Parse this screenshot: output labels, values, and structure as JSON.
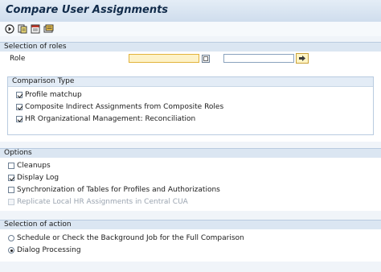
{
  "window": {
    "title": "Compare User Assignments"
  },
  "toolbar": {
    "buttons": [
      {
        "icon": "execute-icon"
      },
      {
        "icon": "get-variant-icon"
      },
      {
        "icon": "save-variant-icon"
      },
      {
        "icon": "program-documentation-icon"
      }
    ]
  },
  "selection_of_roles": {
    "header": "Selection of roles",
    "role_label": "Role",
    "role_from": "",
    "role_to": "",
    "comparison_type": {
      "header": "Comparison Type",
      "options": [
        {
          "label": "Profile matchup",
          "checked": true
        },
        {
          "label": "Composite Indirect Assignments from Composite Roles",
          "checked": true
        },
        {
          "label": "HR Organizational Management: Reconciliation",
          "checked": true
        }
      ]
    }
  },
  "options": {
    "header": "Options",
    "items": [
      {
        "label": "Cleanups",
        "checked": false,
        "enabled": true
      },
      {
        "label": "Display Log",
        "checked": true,
        "enabled": true
      },
      {
        "label": "Synchronization of Tables for Profiles and Authorizations",
        "checked": false,
        "enabled": true
      },
      {
        "label": "Replicate Local HR Assignments in Central CUA",
        "checked": false,
        "enabled": false
      }
    ]
  },
  "selection_of_action": {
    "header": "Selection of action",
    "items": [
      {
        "label": "Schedule or Check the Background Job for the Full Comparison",
        "selected": false
      },
      {
        "label": "Dialog Processing",
        "selected": true
      }
    ]
  },
  "colors": {
    "title": "#112b4a",
    "required_field": "#fdf2c8",
    "group_header": "#dbe6f2",
    "background": "#f0f4f9"
  }
}
